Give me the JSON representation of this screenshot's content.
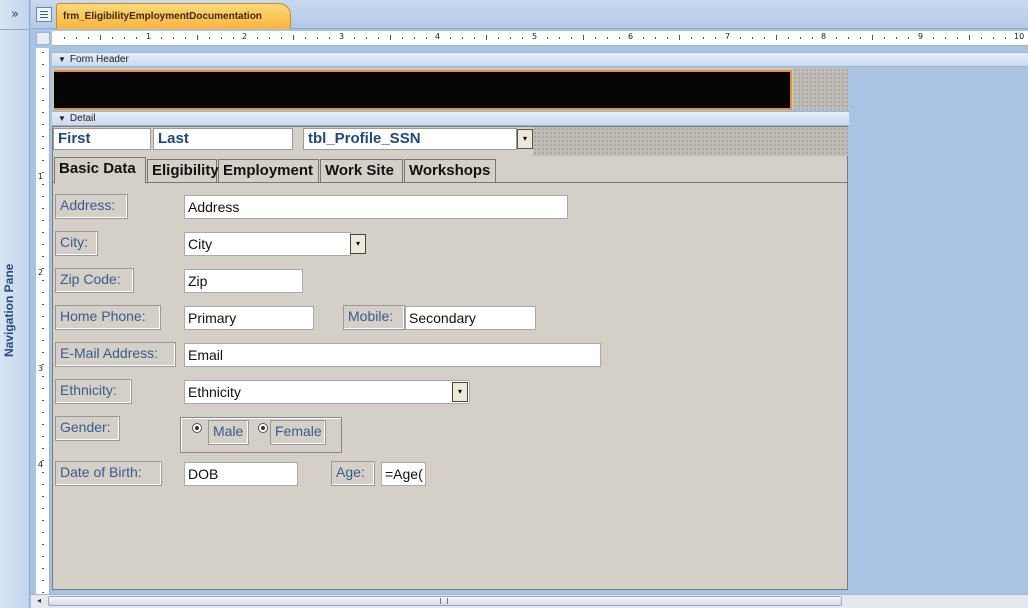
{
  "nav": {
    "expand_glyph": "»",
    "label": "Navigation Pane"
  },
  "document_tab": {
    "title": "frm_EligibilityEmploymentDocumentation"
  },
  "ruler": {
    "labels": [
      "1",
      "2",
      "3",
      "4",
      "5",
      "6",
      "7",
      "8",
      "9",
      "10"
    ],
    "vlabels": [
      "1",
      "2",
      "3",
      "4"
    ]
  },
  "sections": {
    "form_header": "Form Header",
    "detail": "Detail"
  },
  "top_fields": {
    "first": "First",
    "last": "Last",
    "ssn": "tbl_Profile_SSN"
  },
  "tabs": [
    "Basic Data",
    "Eligibility",
    "Employment",
    "Work Site",
    "Workshops"
  ],
  "fields": {
    "address_label": "Address:",
    "address_value": "Address",
    "city_label": "City:",
    "city_value": "City",
    "zip_label": "Zip Code:",
    "zip_value": "Zip",
    "home_phone_label": "Home Phone:",
    "home_phone_value": "Primary",
    "mobile_label": "Mobile:",
    "mobile_value": "Secondary",
    "email_label": "E-Mail Address:",
    "email_value": "Email",
    "ethnicity_label": "Ethnicity:",
    "ethnicity_value": "Ethnicity",
    "gender_label": "Gender:",
    "gender_male": "Male",
    "gender_female": "Female",
    "dob_label": "Date of Birth:",
    "dob_value": "DOB",
    "age_label": "Age:",
    "age_value": "=Age("
  },
  "icons": {
    "dropdown": "▾",
    "scroll_left": "◂",
    "section_arrow": "▼"
  }
}
